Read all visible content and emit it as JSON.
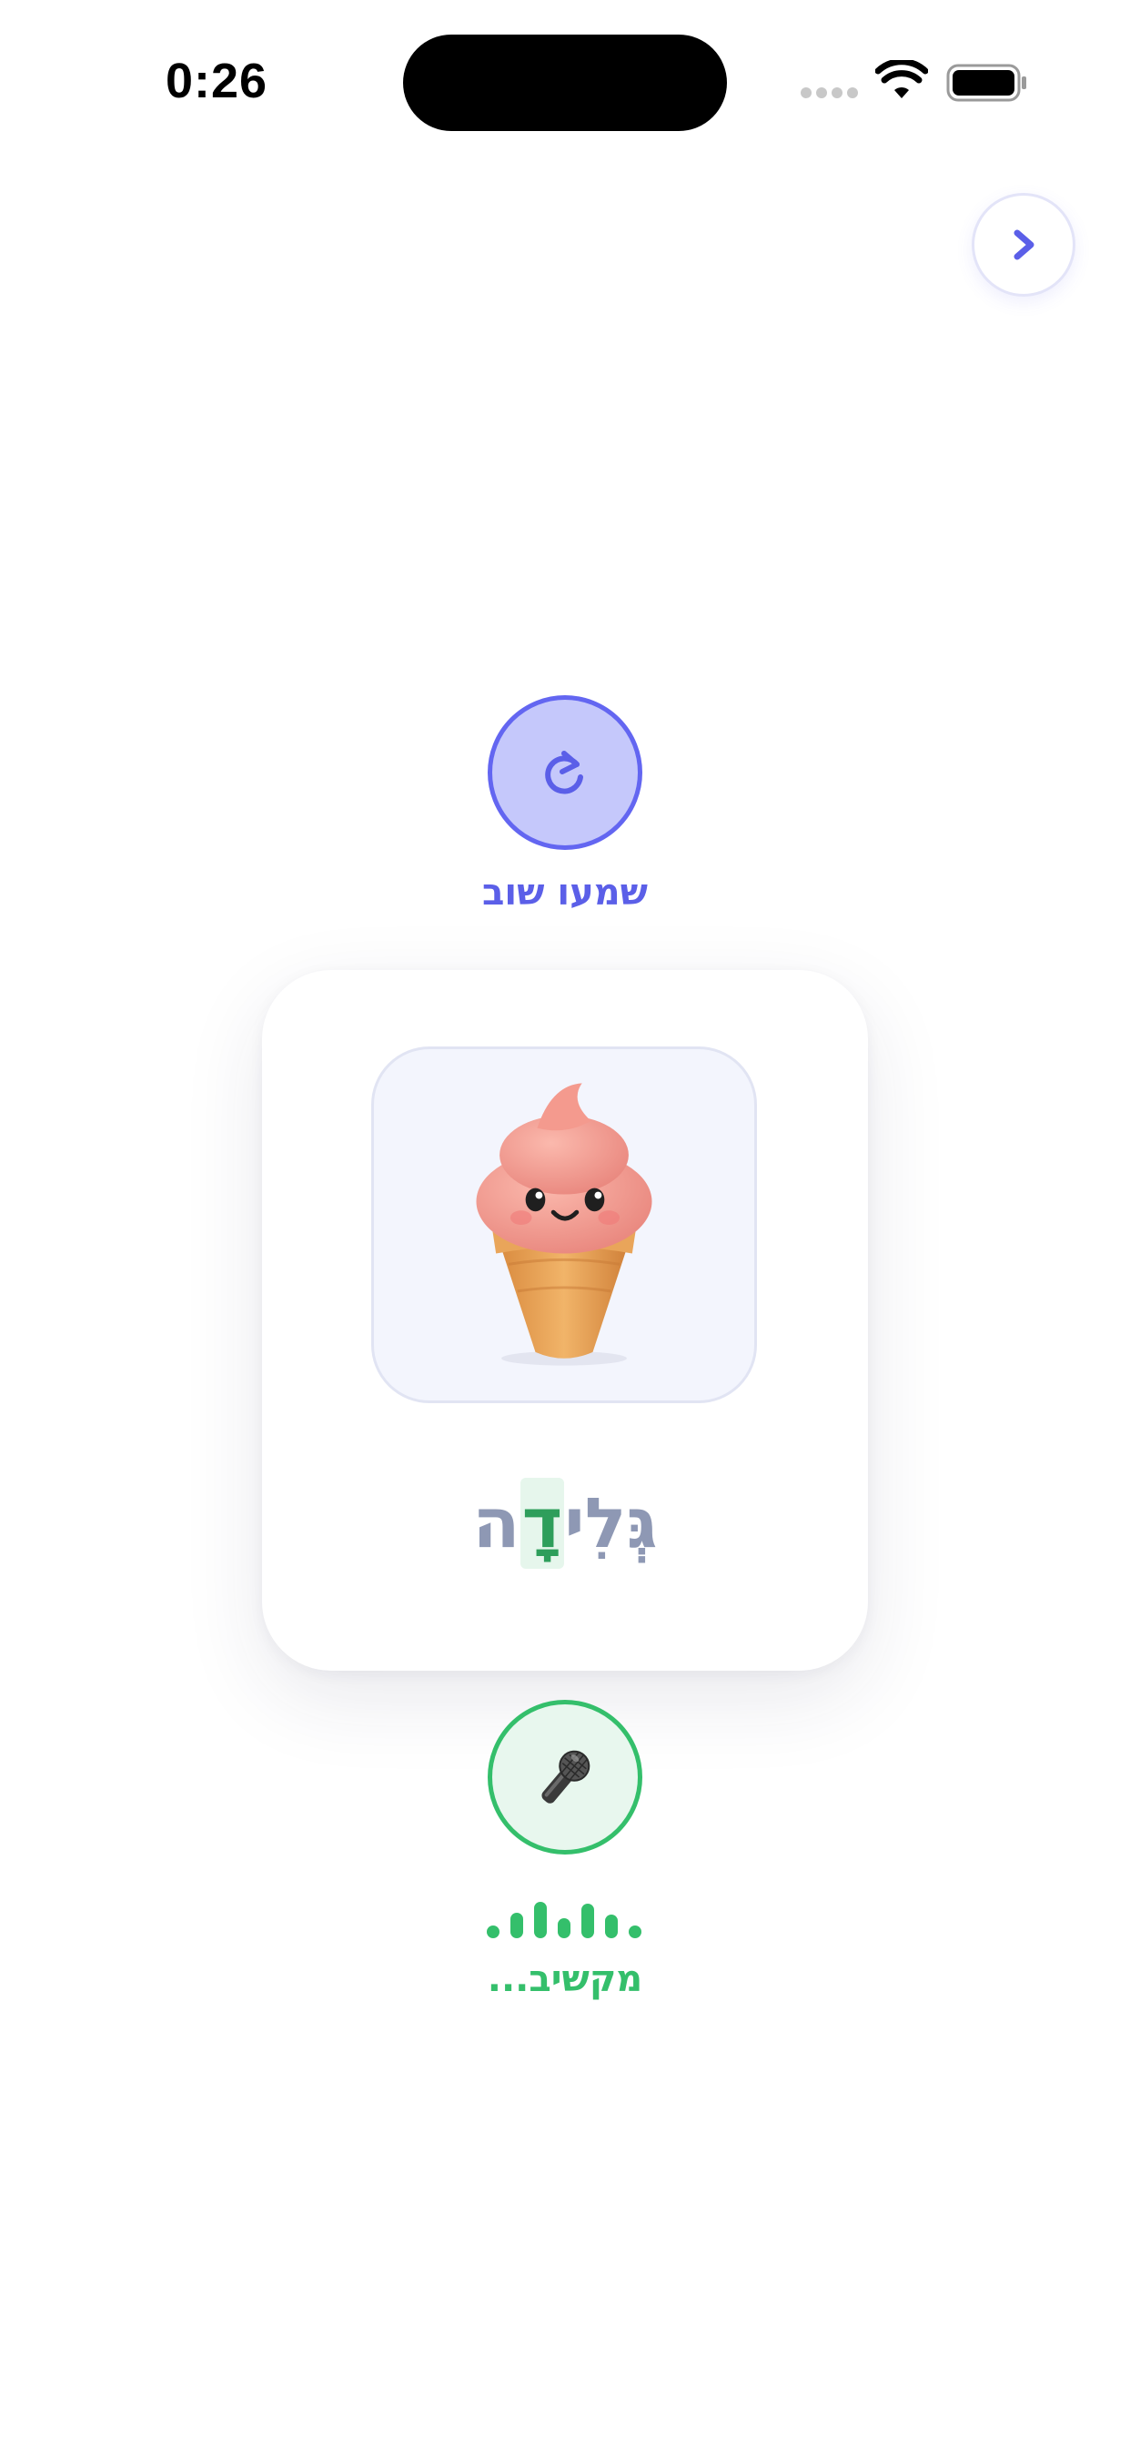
{
  "status_bar": {
    "time": "0:26",
    "icons": [
      "signal-icon",
      "wifi-icon",
      "battery-icon"
    ]
  },
  "navigation": {
    "next_icon": "chevron-right-icon"
  },
  "replay": {
    "icon": "replay-icon",
    "label": "שמעו שוב"
  },
  "card": {
    "image": "ice-cream-cone-illustration",
    "word_syllables": [
      "גְּלִ",
      "י",
      "דָ",
      "ה"
    ],
    "highlighted_syllable_index": 2
  },
  "microphone": {
    "icon": "microphone-icon",
    "status_label": "מקשיב..."
  },
  "colors": {
    "accent": "#6366f1",
    "accent_light": "#c5c8fb",
    "success": "#34bf6b",
    "success_light": "#e8f7ee",
    "word_muted": "#8e98b4",
    "word_highlight": "#2e9e5b"
  }
}
